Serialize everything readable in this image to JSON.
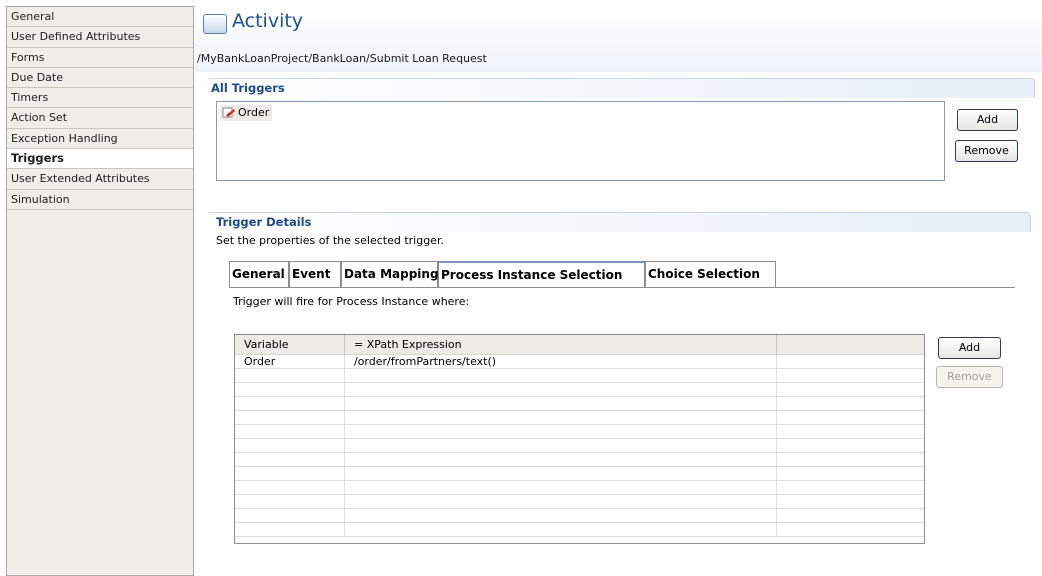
{
  "sidebar": {
    "items": [
      {
        "label": "General"
      },
      {
        "label": "User Defined Attributes"
      },
      {
        "label": "Forms"
      },
      {
        "label": "Due Date"
      },
      {
        "label": "Timers"
      },
      {
        "label": "Action Set"
      },
      {
        "label": "Exception Handling"
      },
      {
        "label": "Triggers",
        "active": true
      },
      {
        "label": "User Extended Attributes"
      },
      {
        "label": "Simulation"
      }
    ]
  },
  "header": {
    "title": "Activity",
    "breadcrumb": "/MyBankLoanProject/BankLoan/Submit Loan Request"
  },
  "all_triggers": {
    "section_title": "All Triggers",
    "items": [
      "Order"
    ],
    "add_label": "Add",
    "remove_label": "Remove"
  },
  "trigger_details": {
    "section_title": "Trigger Details",
    "subtitle": "Set the properties of the selected trigger.",
    "tabs": [
      {
        "label": "General"
      },
      {
        "label": "Event"
      },
      {
        "label": "Data Mapping"
      },
      {
        "label": "Process Instance Selection",
        "selected": true
      },
      {
        "label": "Choice Selection"
      }
    ],
    "fire_text": "Trigger will fire for Process Instance where:",
    "table": {
      "columns": [
        "Variable",
        "= XPath Expression",
        ""
      ],
      "rows": [
        [
          "Order",
          "/order/fromPartners/text()",
          ""
        ]
      ]
    },
    "add_label": "Add",
    "remove_label": "Remove"
  },
  "colors": {
    "title_blue": "#1f4f95",
    "section_blue": "#1e4a8c"
  }
}
